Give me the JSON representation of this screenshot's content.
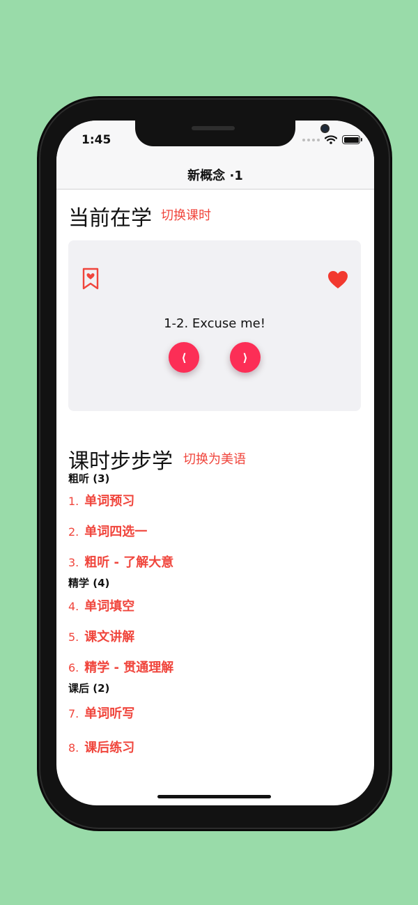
{
  "status": {
    "time": "1:45"
  },
  "nav": {
    "title": "新概念 ·1"
  },
  "current": {
    "title": "当前在学",
    "action": "切换课时",
    "lesson_title": "1-2. Excuse me!",
    "prev_label": "⟨",
    "next_label": "⟩"
  },
  "steps_section": {
    "title": "课时步步学",
    "action": "切换为美语",
    "groups": [
      {
        "label": "粗听 (3)"
      },
      {
        "label": "精学 (4)"
      },
      {
        "label": "课后 (2)"
      }
    ],
    "steps": [
      {
        "num": "1.",
        "label": "单词预习"
      },
      {
        "num": "2.",
        "label": "单词四选一"
      },
      {
        "num": "3.",
        "label": "粗听 - 了解大意"
      },
      {
        "num": "4.",
        "label": "单词填空"
      },
      {
        "num": "5.",
        "label": "课文讲解"
      },
      {
        "num": "6.",
        "label": "精学 - 贯通理解"
      },
      {
        "num": "7.",
        "label": "单词听写"
      },
      {
        "num": "8.",
        "label": "课后练习"
      }
    ]
  },
  "colors": {
    "background": "#99dba9",
    "accent": "#f0453c",
    "button": "#fc2e56",
    "card": "#f1f1f4"
  },
  "icons": [
    "wifi-icon",
    "battery-icon",
    "bookmark-heart-icon",
    "heart-icon",
    "chevron-left-icon",
    "chevron-right-icon"
  ]
}
